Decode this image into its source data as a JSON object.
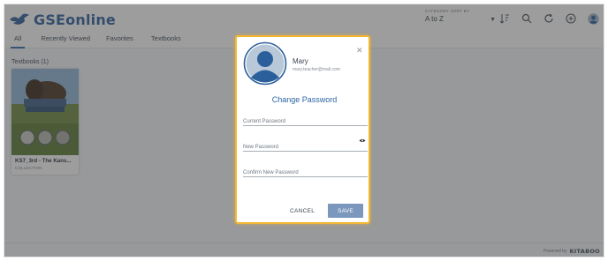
{
  "app": {
    "logo_text": "GSEonline",
    "sort_label": "CATEGORY SORT BY",
    "sort_value": "A to Z"
  },
  "header_icons": [
    "sort-order-icon",
    "search-icon",
    "refresh-icon",
    "add-icon",
    "profile-icon"
  ],
  "tabs": [
    {
      "label": "All",
      "active": true
    },
    {
      "label": "Recently Viewed",
      "active": false
    },
    {
      "label": "Favorites",
      "active": false
    },
    {
      "label": "Textbooks",
      "active": false
    }
  ],
  "section_title": "Textbooks (1)",
  "book": {
    "title": "KS7_3rd - The Kans...",
    "subtitle": "COLLECTION"
  },
  "footer": {
    "powered_by": "Powered by",
    "brand": "KITABOO"
  },
  "modal": {
    "user_name": "Mary",
    "user_email": "mary.teacher@mail.com",
    "title": "Change Password",
    "current_password_placeholder": "Current Password",
    "new_password_placeholder": "New Password",
    "confirm_password_placeholder": "Confirm New Password",
    "cancel_label": "CANCEL",
    "save_label": "SAVE"
  },
  "colors": {
    "brand_blue": "#2b5f9c",
    "modal_border": "#f2b632",
    "save_button": "#7b97bd",
    "overlay": "rgba(60,60,60,0.5)"
  }
}
